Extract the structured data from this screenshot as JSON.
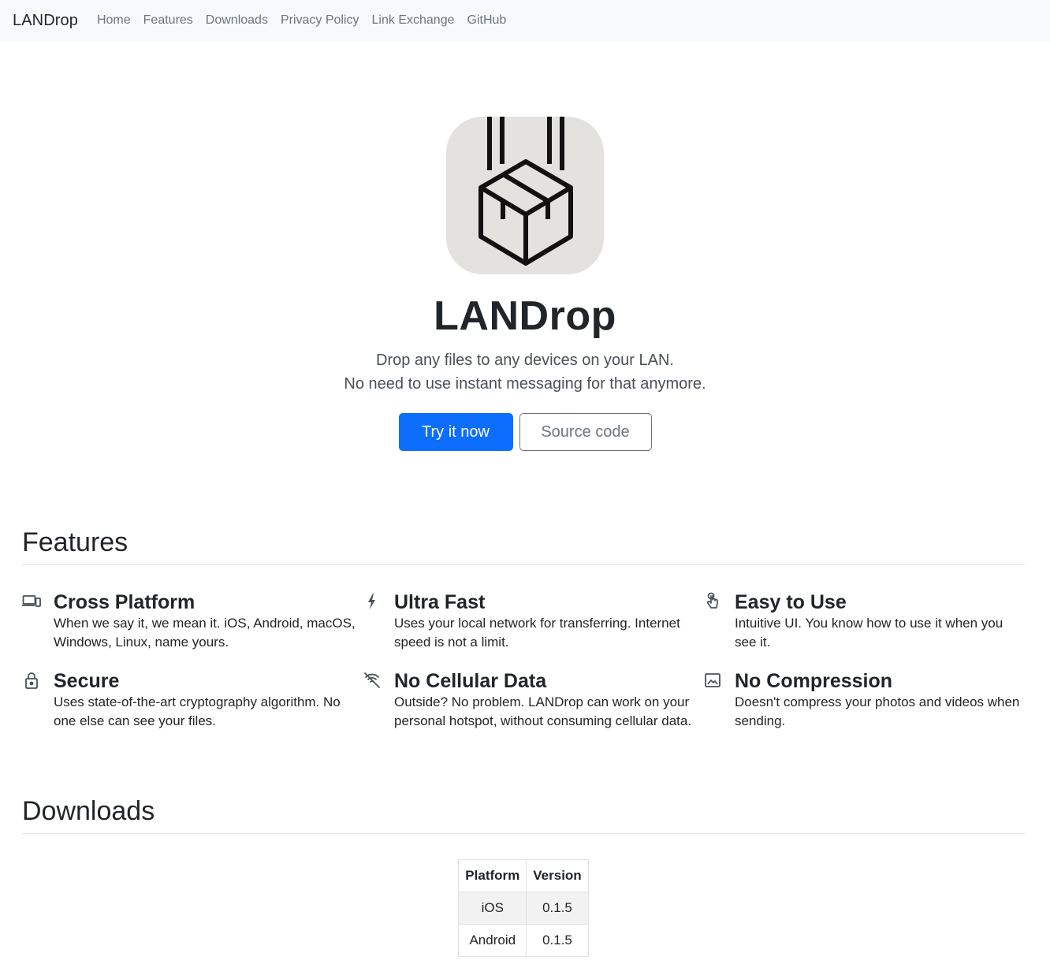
{
  "nav": {
    "brand": "LANDrop",
    "links": [
      "Home",
      "Features",
      "Downloads",
      "Privacy Policy",
      "Link Exchange",
      "GitHub"
    ]
  },
  "hero": {
    "logo_icon": "landrop-box-icon",
    "logo_bg": "#e3e2df",
    "title": "LANDrop",
    "lead_line1": "Drop any files to any devices on your LAN.",
    "lead_line2": "No need to use instant messaging for that anymore.",
    "primary_button": "Try it now",
    "secondary_button": "Source code"
  },
  "features": {
    "title": "Features",
    "items": [
      {
        "icon": "devices-icon",
        "title": "Cross Platform",
        "text": "When we say it, we mean it. iOS, Android, macOS, Windows, Linux, name yours."
      },
      {
        "icon": "lightning-icon",
        "title": "Ultra Fast",
        "text": "Uses your local network for transferring. Internet speed is not a limit."
      },
      {
        "icon": "hand-pointer-icon",
        "title": "Easy to Use",
        "text": "Intuitive UI. You know how to use it when you see it."
      },
      {
        "icon": "lock-icon",
        "title": "Secure",
        "text": "Uses state-of-the-art cryptography algorithm. No one else can see your files."
      },
      {
        "icon": "no-signal-icon",
        "title": "No Cellular Data",
        "text": "Outside? No problem. LANDrop can work on your personal hotspot, without consuming cellular data."
      },
      {
        "icon": "image-icon",
        "title": "No Compression",
        "text": "Doesn't compress your photos and videos when sending."
      }
    ]
  },
  "downloads": {
    "title": "Downloads",
    "headers": [
      "Platform",
      "Version"
    ],
    "rows": [
      [
        "iOS",
        "0.1.5"
      ],
      [
        "Android",
        "0.1.5"
      ]
    ]
  },
  "colors": {
    "primary": "#0d6efd",
    "navbar_bg": "#f8f9fa",
    "muted": "#6c757d"
  }
}
